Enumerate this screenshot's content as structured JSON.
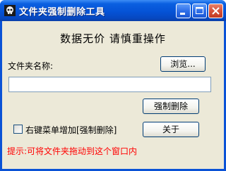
{
  "window": {
    "title": "文件夹强制删除工具",
    "controls": {
      "minimize": "minimize-icon",
      "maximize": "maximize-icon",
      "close": "close-icon"
    }
  },
  "main": {
    "slogan": "数据无价  请慎重操作",
    "folder_label": "文件夹名称:",
    "browse_button": "浏览...",
    "folder_input_value": "",
    "force_delete_button": "强制删除",
    "context_menu_checkbox_label": "右键菜单增加[强制删除]",
    "context_menu_checked": false,
    "about_button": "关于",
    "hint": "提示:可将文件夹拖动到这个窗口内"
  },
  "colors": {
    "title_bar": "#0553d6",
    "window_bg": "#ece9d8",
    "hint_text": "#ff0000"
  }
}
